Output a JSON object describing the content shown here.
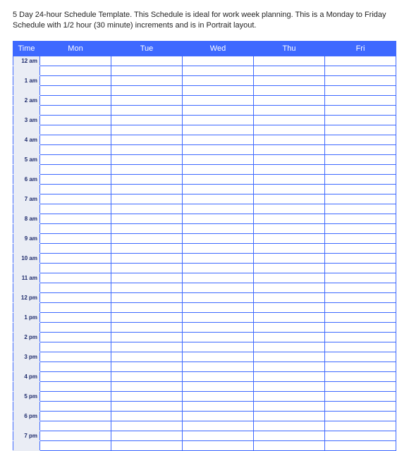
{
  "description": "5 Day 24-hour Schedule Template.  This Schedule is ideal for work week planning.  This is a Monday to Friday Schedule with 1/2 hour (30 minute) increments and is in Portrait layout.",
  "header": {
    "time": "Time",
    "days": [
      "Mon",
      "Tue",
      "Wed",
      "Thu",
      "Fri"
    ]
  },
  "rows": [
    {
      "label": "12 am",
      "half": ""
    },
    {
      "label": "1 am",
      "half": ""
    },
    {
      "label": "2 am",
      "half": ""
    },
    {
      "label": "3 am",
      "half": ""
    },
    {
      "label": "4 am",
      "half": ""
    },
    {
      "label": "5 am",
      "half": ""
    },
    {
      "label": "6 am",
      "half": ""
    },
    {
      "label": "7 am",
      "half": ""
    },
    {
      "label": "8 am",
      "half": ""
    },
    {
      "label": "9 am",
      "half": ""
    },
    {
      "label": "10 am",
      "half": ""
    },
    {
      "label": "11 am",
      "half": ""
    },
    {
      "label": "12 pm",
      "half": ""
    },
    {
      "label": "1 pm",
      "half": ""
    },
    {
      "label": "2 pm",
      "half": ""
    },
    {
      "label": "3 pm",
      "half": ""
    },
    {
      "label": "4 pm",
      "half": ""
    },
    {
      "label": "5 pm",
      "half": ""
    },
    {
      "label": "6 pm",
      "half": ""
    },
    {
      "label": "7 pm",
      "half": ""
    }
  ]
}
